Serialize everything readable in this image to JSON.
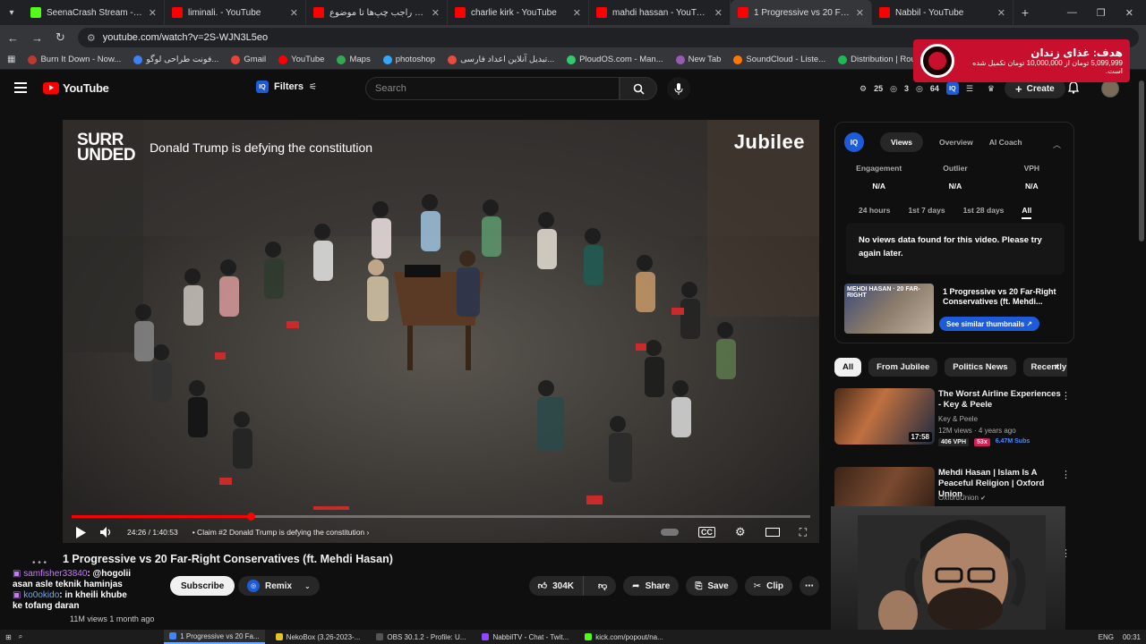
{
  "browser": {
    "tabs": [
      {
        "title": "SeenaCrash Stream - Watch Liv",
        "color": "#53fc18",
        "active": false
      },
      {
        "title": "liminali. - YouTube",
        "color": "#ff0000",
        "active": false
      },
      {
        "title": "از صحبت راجب چپ‌ها تا موضوع",
        "color": "#ff0000",
        "active": false
      },
      {
        "title": "charlie kirk - YouTube",
        "color": "#ff0000",
        "active": false
      },
      {
        "title": "mahdi hassan - YouTube",
        "color": "#ff0000",
        "active": false
      },
      {
        "title": "1 Progressive vs 20 Far-Right C",
        "color": "#ff0000",
        "active": true
      },
      {
        "title": "Nabbil - YouTube",
        "color": "#ff0000",
        "active": false
      }
    ],
    "url": "youtube.com/watch?v=2S-WJN3L5eo",
    "bookmarks": [
      {
        "label": "Burn It Down - Now...",
        "color": "#c0392b"
      },
      {
        "label": "فونت طراحی لوگو...",
        "color": "#3b82f6"
      },
      {
        "label": "Gmail",
        "color": "#ea4335"
      },
      {
        "label": "YouTube",
        "color": "#ff0000"
      },
      {
        "label": "Maps",
        "color": "#34a853"
      },
      {
        "label": "photoshop",
        "color": "#31a8ff"
      },
      {
        "label": "تبدیل آنلاین اعداد فارسی...",
        "color": "#e74c3c"
      },
      {
        "label": "PloudOS.com - Man...",
        "color": "#2ecc71"
      },
      {
        "label": "New Tab",
        "color": "#9b59b6"
      },
      {
        "label": "SoundCloud - Liste...",
        "color": "#ff7700"
      },
      {
        "label": "Distribution | Route...",
        "color": "#1db954"
      }
    ]
  },
  "goal": {
    "title": "هدف: غذای زندان",
    "subtitle": "5,099,999 تومان از 10,000,000 تومان تکمیل شده است."
  },
  "header": {
    "brand": "YouTube",
    "filters_label": "Filters",
    "search_placeholder": "Search",
    "stat_a": "25",
    "stat_b": "3",
    "stat_c": "64",
    "create_label": "Create"
  },
  "player": {
    "brand_left": "SURR\nOUNDED",
    "overlay_title": "Donald Trump is defying the constitution",
    "brand_right": "Jubilee",
    "time": "24:26 / 1:40:53",
    "chapter": "• Claim #2 Donald Trump is defying the constitution",
    "progress_fraction": 0.242
  },
  "video": {
    "title": "1 Progressive vs 20 Far-Right Conservatives (ft. Mehdi Hasan)",
    "subscribe_label": "Subscribe",
    "remix_label": "Remix",
    "likes": "304K",
    "share_label": "Share",
    "save_label": "Save",
    "clip_label": "Clip",
    "views_line": "11M views  1 month ago"
  },
  "chat": [
    {
      "user": "samfisher33840",
      "message": ": @hogolii"
    },
    {
      "user": "",
      "message": "asan asle teknik haminjas"
    },
    {
      "user": "ko0okido",
      "message": ": in kheili khube"
    },
    {
      "user": "",
      "message": "ke tofang daran"
    }
  ],
  "vidiq": {
    "tabs": [
      "Views",
      "Overview",
      "AI Coach"
    ],
    "metrics": [
      {
        "label": "Engagement",
        "value": "N/A"
      },
      {
        "label": "Outlier",
        "value": "N/A"
      },
      {
        "label": "VPH",
        "value": "N/A"
      }
    ],
    "ranges": [
      "24 hours",
      "1st 7 days",
      "1st 28 days",
      "All"
    ],
    "empty_message": "No views data found for this video. Please try again later.",
    "similar_title": "1 Progressive vs 20 Far-Right Conservatives (ft. Mehdi...",
    "similar_thumb_caption": "MEHDI HASAN · 20 FAR-RIGHT",
    "similar_button": "See similar thumbnails ↗"
  },
  "chips": [
    "All",
    "From Jubilee",
    "Politics News",
    "Recently"
  ],
  "related": [
    {
      "title": "The Worst Airline Experiences - Key & Peele",
      "channel": "Key & Peele",
      "meta": "12M views · 4 years ago",
      "duration": "17:58",
      "vph": "406 VPH",
      "multiplier": "53x",
      "subs": "6.47M Subs"
    },
    {
      "title": "Mehdi Hasan | Islam Is A Peaceful Religion | Oxford Union",
      "channel": "OxfordUnion",
      "meta": "",
      "duration": "",
      "vph": "",
      "multiplier": "",
      "subs": ""
    }
  ],
  "taskbar": {
    "items": [
      {
        "label": "1 Progressive vs 20 Fa...",
        "color": "#4285f4",
        "active": true
      },
      {
        "label": "NekoBox (3.26-2023-...",
        "color": "#e6c229",
        "active": false
      },
      {
        "label": "OBS 30.1.2 - Profile: U...",
        "color": "#555555",
        "active": false
      },
      {
        "label": "NabbilTV - Chat - Twit...",
        "color": "#9146ff",
        "active": false
      },
      {
        "label": "kick.com/popout/na...",
        "color": "#53fc18",
        "active": false
      }
    ],
    "lang": "ENG",
    "clock": "00:31"
  },
  "colors": {
    "accent": "#ff0000",
    "vidiq": "#1e5bd8",
    "bg": "#0f0f0f"
  }
}
